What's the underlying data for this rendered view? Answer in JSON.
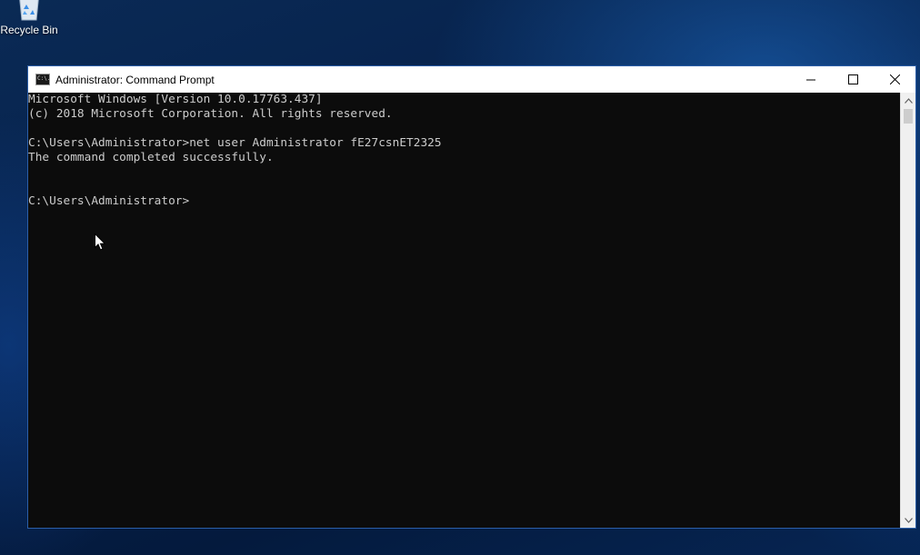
{
  "desktop": {
    "icons": [
      {
        "label": "Recycle Bin",
        "icon": "recycle-bin-icon"
      }
    ]
  },
  "window": {
    "title": "Administrator: Command Prompt",
    "icon": "command-prompt-icon",
    "icon_glyph": "C:\\.",
    "controls": {
      "minimize": "minimize-icon",
      "maximize": "maximize-icon",
      "close": "close-icon"
    }
  },
  "console": {
    "lines": [
      "Microsoft Windows [Version 10.0.17763.437]",
      "(c) 2018 Microsoft Corporation. All rights reserved.",
      "",
      "C:\\Users\\Administrator>net user Administrator fE27csnET2325",
      "The command completed successfully.",
      "",
      "",
      "C:\\Users\\Administrator>"
    ]
  },
  "colors": {
    "console_bg": "#0c0c0c",
    "console_text": "#cccccc",
    "titlebar_bg": "#ffffff",
    "desktop_bg": "#06204a"
  }
}
